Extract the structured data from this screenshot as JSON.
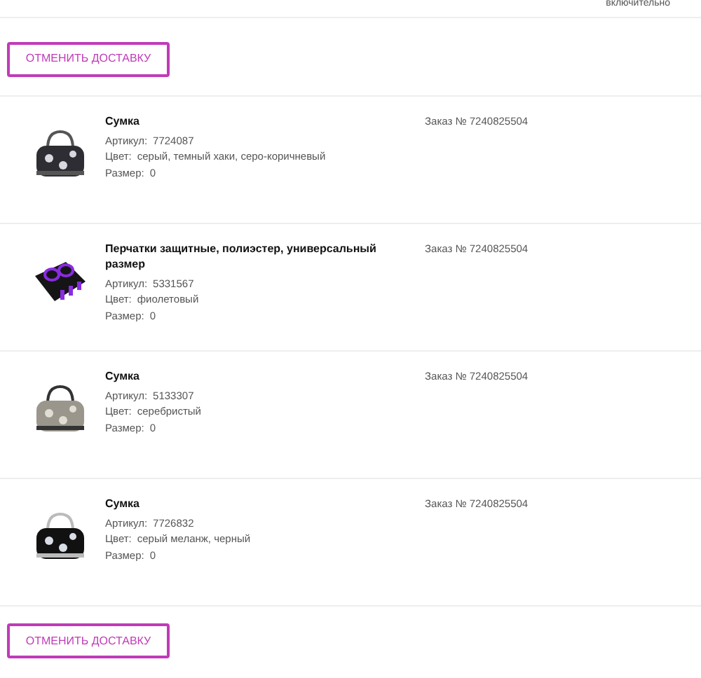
{
  "header_note": "включительно",
  "cancel_buttons": [
    "ОТМЕНИТЬ ДОСТАВКУ",
    "ОТМЕНИТЬ ДОСТАВКУ"
  ],
  "items": [
    {
      "name": "Сумка",
      "order": "Заказ № 7240825504",
      "article_label": "Артикул:",
      "article": "7724087",
      "color_label": "Цвет:",
      "color_value": "серый, темный хаки, серо-коричневый",
      "size_label": "Размер:",
      "size": "0"
    },
    {
      "name": "Перчатки защитные, полиэстер, универсальный размер",
      "order": "Заказ № 7240825504",
      "article_label": "Артикул:",
      "article": "5331567",
      "color_label": "Цвет:",
      "color_value": "фиолетовый",
      "size_label": "Размер:",
      "size": "0"
    },
    {
      "name": "Сумка",
      "order": "Заказ № 7240825504",
      "article_label": "Артикул:",
      "article": "5133307",
      "color_label": "Цвет:",
      "color_value": "серебристый",
      "size_label": "Размер:",
      "size": "0"
    },
    {
      "name": "Сумка",
      "order": "Заказ № 7240825504",
      "article_label": "Артикул:",
      "article": "7726832",
      "color_label": "Цвет:",
      "color_value": "серый меланж, черный",
      "size_label": "Размер:",
      "size": "0"
    }
  ]
}
